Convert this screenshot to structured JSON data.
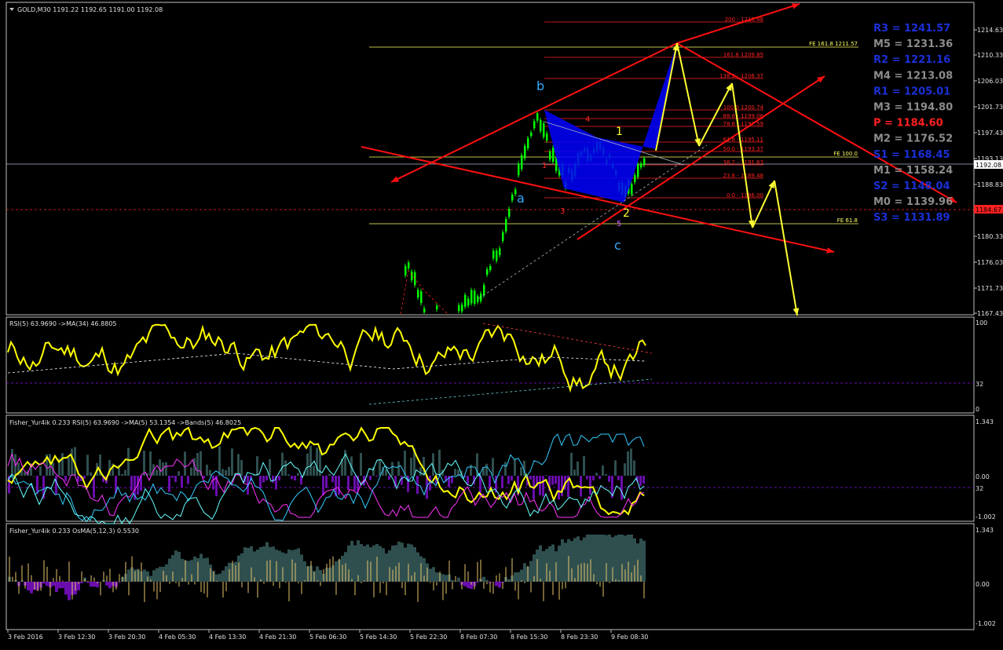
{
  "main": {
    "symbol_header": "GOLD,M30  1191.22 1192.65 1191.00 1192.08",
    "price_axis": [
      "1214.63",
      "1210.33",
      "1206.03",
      "1201.73",
      "1197.43",
      "1193.13",
      "1188.83",
      "1184.53",
      "1180.33",
      "1176.03",
      "1171.73",
      "1167.43"
    ],
    "current_price_tag": "1192.08",
    "red_level_tag": "1184.67",
    "fib_labels": [
      "200 - 1215.48",
      "161.8 1209.85",
      "138.2 - 1206.37",
      "100.0 1200.74",
      "88.6 - 1199.06",
      "78.6 - 1197.59",
      "61.8 - 1195.11",
      "50.0 - 1193.37",
      "38.2 - 1191.63",
      "23.6 - 1189.48",
      "0.0 - 1186.00"
    ],
    "fe_labels": [
      "FE 161.8 1211.57",
      "FE 100.0",
      "FE 61.8"
    ],
    "wave_labels": {
      "a": "a",
      "b": "b",
      "c": "c",
      "one": "1",
      "two": "2",
      "three": "3",
      "four": "4",
      "five": "5",
      "one_red": "1"
    },
    "pivots": [
      {
        "label": "R3 = 1241.57",
        "color": "#1b2fd6"
      },
      {
        "label": "M5 = 1231.36",
        "color": "#8c8c8c"
      },
      {
        "label": "R2 = 1221.16",
        "color": "#1b2fd6"
      },
      {
        "label": "M4 = 1213.08",
        "color": "#8c8c8c"
      },
      {
        "label": "R1 = 1205.01",
        "color": "#1b2fd6"
      },
      {
        "label": "M3 = 1194.80",
        "color": "#8c8c8c"
      },
      {
        "label": "P   = 1184.60",
        "color": "#ff2020"
      },
      {
        "label": "M2 = 1176.52",
        "color": "#8c8c8c"
      },
      {
        "label": "S1 = 1168.45",
        "color": "#1b2fd6"
      },
      {
        "label": "M1 = 1158.24",
        "color": "#8c8c8c"
      },
      {
        "label": "S2 = 1148.04",
        "color": "#1b2fd6"
      },
      {
        "label": "M0 = 1139.96",
        "color": "#8c8c8c"
      },
      {
        "label": "S3 = 1131.89",
        "color": "#1b2fd6"
      }
    ]
  },
  "rsi_panel": {
    "header": "RSI(5) 63.9690  ->MA(34) 46.8805",
    "axis": [
      "100",
      "32",
      "0"
    ]
  },
  "fisher_panel": {
    "header": "Fisher_Yur4ik 0.233  RSI(5) 63.9690  ->MA(5) 53.1354  ->Bands(5) 46.8025",
    "axis": [
      "1.343",
      "0.00",
      "32",
      "-1.002"
    ]
  },
  "osma_panel": {
    "header": "Fisher_Yur4ik 0.233  OsMA(5,12,3) 0.5530",
    "axis": [
      "1.343",
      "0.00",
      "-1.002"
    ]
  },
  "time_axis": [
    "3 Feb 2016",
    "3 Feb 12:30",
    "3 Feb 20:30",
    "4 Feb 05:30",
    "4 Feb 13:30",
    "4 Feb 21:30",
    "5 Feb 06:30",
    "5 Feb 14:30",
    "5 Feb 22:30",
    "8 Feb 07:30",
    "8 Feb 15:30",
    "8 Feb 23:30",
    "9 Feb 08:30"
  ],
  "colors": {
    "candle": "#00ff00",
    "rsi": "#ffff00",
    "fib": "#ff2020",
    "trend": "#ff1010",
    "arrow": "#ffff33",
    "pattern": "#0000ff",
    "hist": "#2f4f4f",
    "neg_hist": "#6a0dad"
  },
  "chart_data": [
    {
      "type": "line",
      "title": "GOLD,M30",
      "x": [
        "3 Feb 2016",
        "3 Feb 12:30",
        "3 Feb 20:30",
        "4 Feb 05:30",
        "4 Feb 13:30",
        "4 Feb 21:30",
        "5 Feb 06:30",
        "5 Feb 14:30",
        "5 Feb 22:30",
        "8 Feb 07:30",
        "8 Feb 15:30",
        "8 Feb 23:30",
        "9 Feb 08:30"
      ],
      "series": [
        {
          "name": "",
          "values": [
            1168,
            1167,
            1166,
            1166,
            1166,
            1166,
            1166,
            1166,
            1170,
            1180,
            1200,
            1188,
            1192.08
          ]
        }
      ],
      "ylim": [
        1167.43,
        1214.63
      ]
    },
    {
      "type": "line",
      "title": "RSI(5)",
      "x": [
        "3 Feb 2016",
        "9 Feb 08:30"
      ],
      "series": [
        {
          "name": "",
          "values": [
            50,
            63.969
          ]
        }
      ],
      "ylim": [
        0,
        100
      ]
    }
  ]
}
